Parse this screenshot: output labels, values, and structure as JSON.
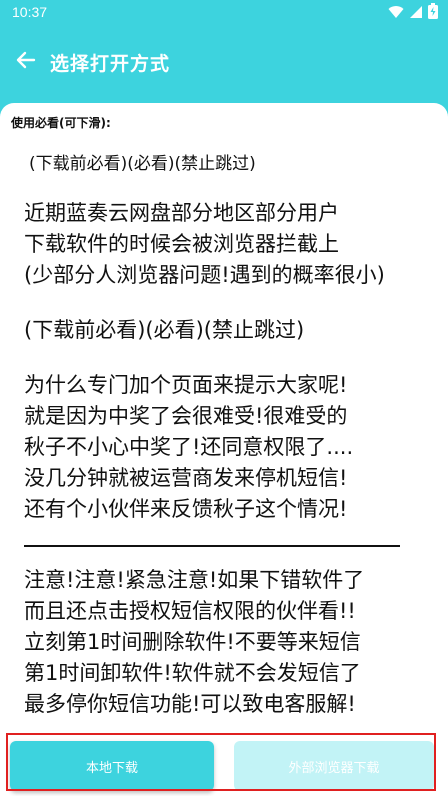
{
  "status_bar": {
    "time": "10:37",
    "icons": [
      "wifi-icon",
      "signal-icon",
      "battery-icon"
    ]
  },
  "app_bar": {
    "title": "选择打开方式",
    "back_icon": "arrow-left-icon"
  },
  "notice": {
    "heading": "使用必看(可下滑):",
    "paragraphs": [
      "(下载前必看)(必看)(禁止跳过)",
      "近期蓝奏云网盘部分地区部分用户\n下载软件的时候会被浏览器拦截上\n(少部分人浏览器问题!遇到的概率很小)",
      "(下载前必看)(必看)(禁止跳过)",
      "为什么专门加个页面来提示大家呢!\n就是因为中奖了会很难受!很难受的\n秋子不小心中奖了!还同意权限了....\n没几分钟就被运营商发来停机短信!\n还有个小伙伴来反馈秋子这个情况!",
      "注意!注意!紧急注意!如果下错软件了\n而且还点击授权短信权限的伙伴看!!\n立刻第1时间删除软件!不要等来短信\n第1时间卸软件!软件就不会发短信了\n最多停你短信功能!可以致电客服解!"
    ]
  },
  "buttons": {
    "local_download": "本地下载",
    "external_browser_download": "外部浏览器下载"
  },
  "colors": {
    "accent": "#3dd3de",
    "accent_light": "#c2f3f6",
    "highlight_frame": "#e02020"
  }
}
